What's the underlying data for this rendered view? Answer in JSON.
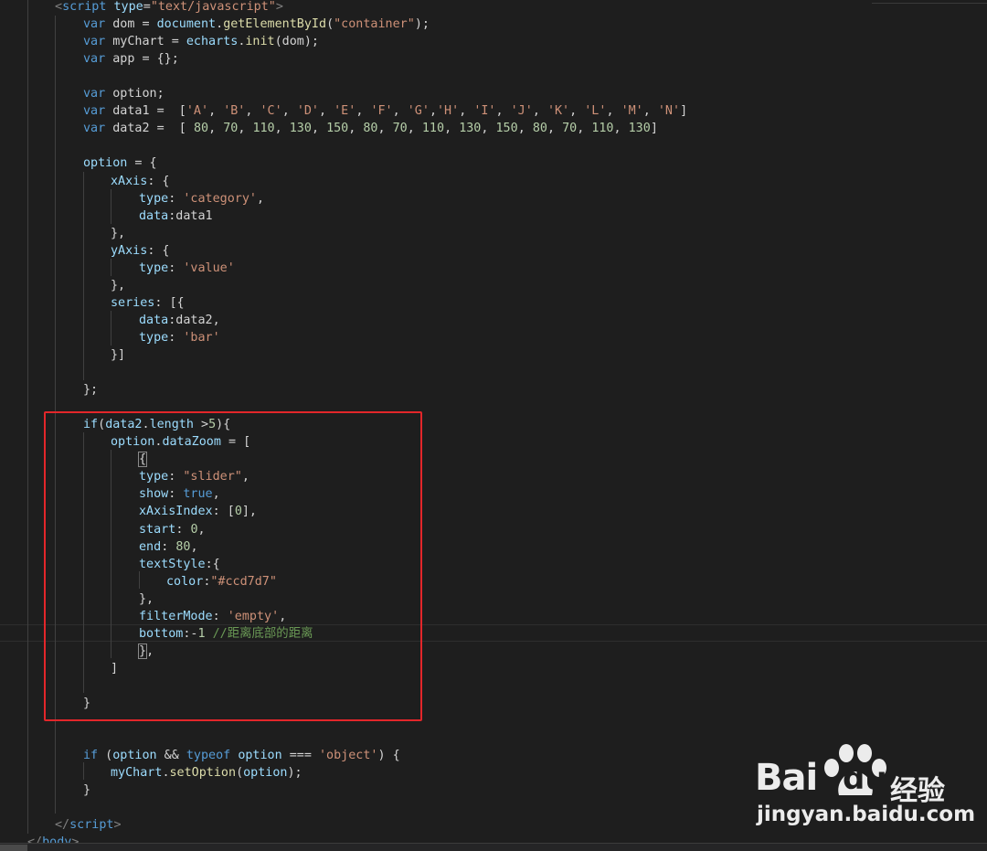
{
  "editor": {
    "theme": "dark",
    "background": "#1e1e1e",
    "highlight_box_color": "#e3262a",
    "lines": [
      {
        "tokens": [
          {
            "t": "<",
            "c": "t"
          },
          {
            "t": "script",
            "c": "k"
          },
          {
            "t": " ",
            "c": "p"
          },
          {
            "t": "type",
            "c": "v"
          },
          {
            "t": "=",
            "c": "p"
          },
          {
            "t": "\"text/javascript\"",
            "c": "s"
          },
          {
            "t": ">",
            "c": "t"
          }
        ]
      },
      {
        "tokens": [
          {
            "t": "var",
            "c": "k"
          },
          {
            "t": " dom = ",
            "c": "p"
          },
          {
            "t": "document",
            "c": "v"
          },
          {
            "t": ".",
            "c": "p"
          },
          {
            "t": "getElementById",
            "c": "f"
          },
          {
            "t": "(",
            "c": "p"
          },
          {
            "t": "\"container\"",
            "c": "s"
          },
          {
            "t": ");",
            "c": "p"
          }
        ]
      },
      {
        "tokens": [
          {
            "t": "var",
            "c": "k"
          },
          {
            "t": " myChart = ",
            "c": "p"
          },
          {
            "t": "echarts",
            "c": "v"
          },
          {
            "t": ".",
            "c": "p"
          },
          {
            "t": "init",
            "c": "f"
          },
          {
            "t": "(dom);",
            "c": "p"
          }
        ]
      },
      {
        "tokens": [
          {
            "t": "var",
            "c": "k"
          },
          {
            "t": " app = {};",
            "c": "p"
          }
        ]
      },
      {
        "tokens": []
      },
      {
        "tokens": [
          {
            "t": "var",
            "c": "k"
          },
          {
            "t": " option;",
            "c": "p"
          }
        ]
      },
      {
        "tokens": [
          {
            "t": "var",
            "c": "k"
          },
          {
            "t": " data1 =  [",
            "c": "p"
          },
          {
            "t": "'A'",
            "c": "s"
          },
          {
            "t": ", ",
            "c": "p"
          },
          {
            "t": "'B'",
            "c": "s"
          },
          {
            "t": ", ",
            "c": "p"
          },
          {
            "t": "'C'",
            "c": "s"
          },
          {
            "t": ", ",
            "c": "p"
          },
          {
            "t": "'D'",
            "c": "s"
          },
          {
            "t": ", ",
            "c": "p"
          },
          {
            "t": "'E'",
            "c": "s"
          },
          {
            "t": ", ",
            "c": "p"
          },
          {
            "t": "'F'",
            "c": "s"
          },
          {
            "t": ", ",
            "c": "p"
          },
          {
            "t": "'G'",
            "c": "s"
          },
          {
            "t": ",",
            "c": "p"
          },
          {
            "t": "'H'",
            "c": "s"
          },
          {
            "t": ", ",
            "c": "p"
          },
          {
            "t": "'I'",
            "c": "s"
          },
          {
            "t": ", ",
            "c": "p"
          },
          {
            "t": "'J'",
            "c": "s"
          },
          {
            "t": ", ",
            "c": "p"
          },
          {
            "t": "'K'",
            "c": "s"
          },
          {
            "t": ", ",
            "c": "p"
          },
          {
            "t": "'L'",
            "c": "s"
          },
          {
            "t": ", ",
            "c": "p"
          },
          {
            "t": "'M'",
            "c": "s"
          },
          {
            "t": ", ",
            "c": "p"
          },
          {
            "t": "'N'",
            "c": "s"
          },
          {
            "t": "]",
            "c": "p"
          }
        ]
      },
      {
        "tokens": [
          {
            "t": "var",
            "c": "k"
          },
          {
            "t": " data2 =  [ ",
            "c": "p"
          },
          {
            "t": "80",
            "c": "n"
          },
          {
            "t": ", ",
            "c": "p"
          },
          {
            "t": "70",
            "c": "n"
          },
          {
            "t": ", ",
            "c": "p"
          },
          {
            "t": "110",
            "c": "n"
          },
          {
            "t": ", ",
            "c": "p"
          },
          {
            "t": "130",
            "c": "n"
          },
          {
            "t": ", ",
            "c": "p"
          },
          {
            "t": "150",
            "c": "n"
          },
          {
            "t": ", ",
            "c": "p"
          },
          {
            "t": "80",
            "c": "n"
          },
          {
            "t": ", ",
            "c": "p"
          },
          {
            "t": "70",
            "c": "n"
          },
          {
            "t": ", ",
            "c": "p"
          },
          {
            "t": "110",
            "c": "n"
          },
          {
            "t": ", ",
            "c": "p"
          },
          {
            "t": "130",
            "c": "n"
          },
          {
            "t": ", ",
            "c": "p"
          },
          {
            "t": "150",
            "c": "n"
          },
          {
            "t": ", ",
            "c": "p"
          },
          {
            "t": "80",
            "c": "n"
          },
          {
            "t": ", ",
            "c": "p"
          },
          {
            "t": "70",
            "c": "n"
          },
          {
            "t": ", ",
            "c": "p"
          },
          {
            "t": "110",
            "c": "n"
          },
          {
            "t": ", ",
            "c": "p"
          },
          {
            "t": "130",
            "c": "n"
          },
          {
            "t": "]",
            "c": "p"
          }
        ]
      },
      {
        "tokens": []
      },
      {
        "tokens": [
          {
            "t": "option",
            "c": "v"
          },
          {
            "t": " = {",
            "c": "p"
          }
        ]
      },
      {
        "tokens": [
          {
            "t": "xAxis",
            "c": "v"
          },
          {
            "t": ": {",
            "c": "p"
          }
        ]
      },
      {
        "tokens": [
          {
            "t": "type",
            "c": "v"
          },
          {
            "t": ": ",
            "c": "p"
          },
          {
            "t": "'category'",
            "c": "s"
          },
          {
            "t": ",",
            "c": "p"
          }
        ]
      },
      {
        "tokens": [
          {
            "t": "data",
            "c": "v"
          },
          {
            "t": ":data1",
            "c": "p"
          }
        ]
      },
      {
        "tokens": [
          {
            "t": "},",
            "c": "p"
          }
        ]
      },
      {
        "tokens": [
          {
            "t": "yAxis",
            "c": "v"
          },
          {
            "t": ": {",
            "c": "p"
          }
        ]
      },
      {
        "tokens": [
          {
            "t": "type",
            "c": "v"
          },
          {
            "t": ": ",
            "c": "p"
          },
          {
            "t": "'value'",
            "c": "s"
          }
        ]
      },
      {
        "tokens": [
          {
            "t": "},",
            "c": "p"
          }
        ]
      },
      {
        "tokens": [
          {
            "t": "series",
            "c": "v"
          },
          {
            "t": ": [{",
            "c": "p"
          }
        ]
      },
      {
        "tokens": [
          {
            "t": "data",
            "c": "v"
          },
          {
            "t": ":data2,",
            "c": "p"
          }
        ]
      },
      {
        "tokens": [
          {
            "t": "type",
            "c": "v"
          },
          {
            "t": ": ",
            "c": "p"
          },
          {
            "t": "'bar'",
            "c": "s"
          }
        ]
      },
      {
        "tokens": [
          {
            "t": "}]",
            "c": "p"
          }
        ]
      },
      {
        "tokens": []
      },
      {
        "tokens": [
          {
            "t": "};",
            "c": "p"
          }
        ]
      },
      {
        "tokens": []
      },
      {
        "tokens": [
          {
            "t": "if",
            "c": "v"
          },
          {
            "t": "(",
            "c": "p"
          },
          {
            "t": "data2",
            "c": "v"
          },
          {
            "t": ".",
            "c": "p"
          },
          {
            "t": "length",
            "c": "v"
          },
          {
            "t": " >",
            "c": "p"
          },
          {
            "t": "5",
            "c": "n"
          },
          {
            "t": "){",
            "c": "p"
          }
        ]
      },
      {
        "tokens": [
          {
            "t": "option",
            "c": "v"
          },
          {
            "t": ".",
            "c": "p"
          },
          {
            "t": "dataZoom",
            "c": "v"
          },
          {
            "t": " = [",
            "c": "p"
          }
        ]
      },
      {
        "tokens": [
          {
            "t": "{",
            "c": "p",
            "box": true
          }
        ]
      },
      {
        "tokens": [
          {
            "t": "type",
            "c": "v"
          },
          {
            "t": ": ",
            "c": "p"
          },
          {
            "t": "\"slider\"",
            "c": "s"
          },
          {
            "t": ",",
            "c": "p"
          }
        ]
      },
      {
        "tokens": [
          {
            "t": "show",
            "c": "v"
          },
          {
            "t": ": ",
            "c": "p"
          },
          {
            "t": "true",
            "c": "k"
          },
          {
            "t": ",",
            "c": "p"
          }
        ]
      },
      {
        "tokens": [
          {
            "t": "xAxisIndex",
            "c": "v"
          },
          {
            "t": ": [",
            "c": "p"
          },
          {
            "t": "0",
            "c": "n"
          },
          {
            "t": "],",
            "c": "p"
          }
        ]
      },
      {
        "tokens": [
          {
            "t": "start",
            "c": "v"
          },
          {
            "t": ": ",
            "c": "p"
          },
          {
            "t": "0",
            "c": "n"
          },
          {
            "t": ",",
            "c": "p"
          }
        ]
      },
      {
        "tokens": [
          {
            "t": "end",
            "c": "v"
          },
          {
            "t": ": ",
            "c": "p"
          },
          {
            "t": "80",
            "c": "n"
          },
          {
            "t": ",",
            "c": "p"
          }
        ]
      },
      {
        "tokens": [
          {
            "t": "textStyle",
            "c": "v"
          },
          {
            "t": ":{",
            "c": "p"
          }
        ]
      },
      {
        "tokens": [
          {
            "t": "color",
            "c": "v"
          },
          {
            "t": ":",
            "c": "p"
          },
          {
            "t": "\"#ccd7d7\"",
            "c": "s"
          }
        ]
      },
      {
        "tokens": [
          {
            "t": "},",
            "c": "p"
          }
        ]
      },
      {
        "tokens": [
          {
            "t": "filterMode",
            "c": "v"
          },
          {
            "t": ": ",
            "c": "p"
          },
          {
            "t": "'empty'",
            "c": "s"
          },
          {
            "t": ",",
            "c": "p"
          }
        ]
      },
      {
        "tokens": [
          {
            "t": "bottom",
            "c": "v"
          },
          {
            "t": ":-",
            "c": "p"
          },
          {
            "t": "1",
            "c": "n"
          },
          {
            "t": " ",
            "c": "p"
          },
          {
            "t": "//距离底部的距离",
            "c": "c"
          }
        ]
      },
      {
        "tokens": [
          {
            "t": "}",
            "c": "p",
            "box": true
          },
          {
            "t": ",",
            "c": "p"
          }
        ]
      },
      {
        "tokens": [
          {
            "t": "]",
            "c": "p"
          }
        ]
      },
      {
        "tokens": []
      },
      {
        "tokens": [
          {
            "t": "}",
            "c": "p"
          }
        ]
      },
      {
        "tokens": []
      },
      {
        "tokens": []
      },
      {
        "tokens": [
          {
            "t": "if",
            "c": "k"
          },
          {
            "t": " (",
            "c": "p"
          },
          {
            "t": "option",
            "c": "v"
          },
          {
            "t": " && ",
            "c": "p"
          },
          {
            "t": "typeof",
            "c": "k"
          },
          {
            "t": " ",
            "c": "p"
          },
          {
            "t": "option",
            "c": "v"
          },
          {
            "t": " === ",
            "c": "p"
          },
          {
            "t": "'object'",
            "c": "s"
          },
          {
            "t": ") {",
            "c": "p"
          }
        ]
      },
      {
        "tokens": [
          {
            "t": "myChart",
            "c": "v"
          },
          {
            "t": ".",
            "c": "p"
          },
          {
            "t": "setOption",
            "c": "f"
          },
          {
            "t": "(",
            "c": "p"
          },
          {
            "t": "option",
            "c": "v"
          },
          {
            "t": ");",
            "c": "p"
          }
        ]
      },
      {
        "tokens": [
          {
            "t": "}",
            "c": "p"
          }
        ]
      },
      {
        "tokens": []
      },
      {
        "tokens": [
          {
            "t": "</",
            "c": "t"
          },
          {
            "t": "script",
            "c": "k"
          },
          {
            "t": ">",
            "c": "t"
          }
        ]
      },
      {
        "tokens": [
          {
            "t": "</",
            "c": "t"
          },
          {
            "t": "body",
            "c": "k"
          },
          {
            "t": ">",
            "c": "t"
          }
        ]
      }
    ]
  },
  "watermark": {
    "brand_bai": "Bai",
    "brand_du": "du",
    "brand_jingyan": "经验",
    "url": "jingyan.baidu.com"
  }
}
